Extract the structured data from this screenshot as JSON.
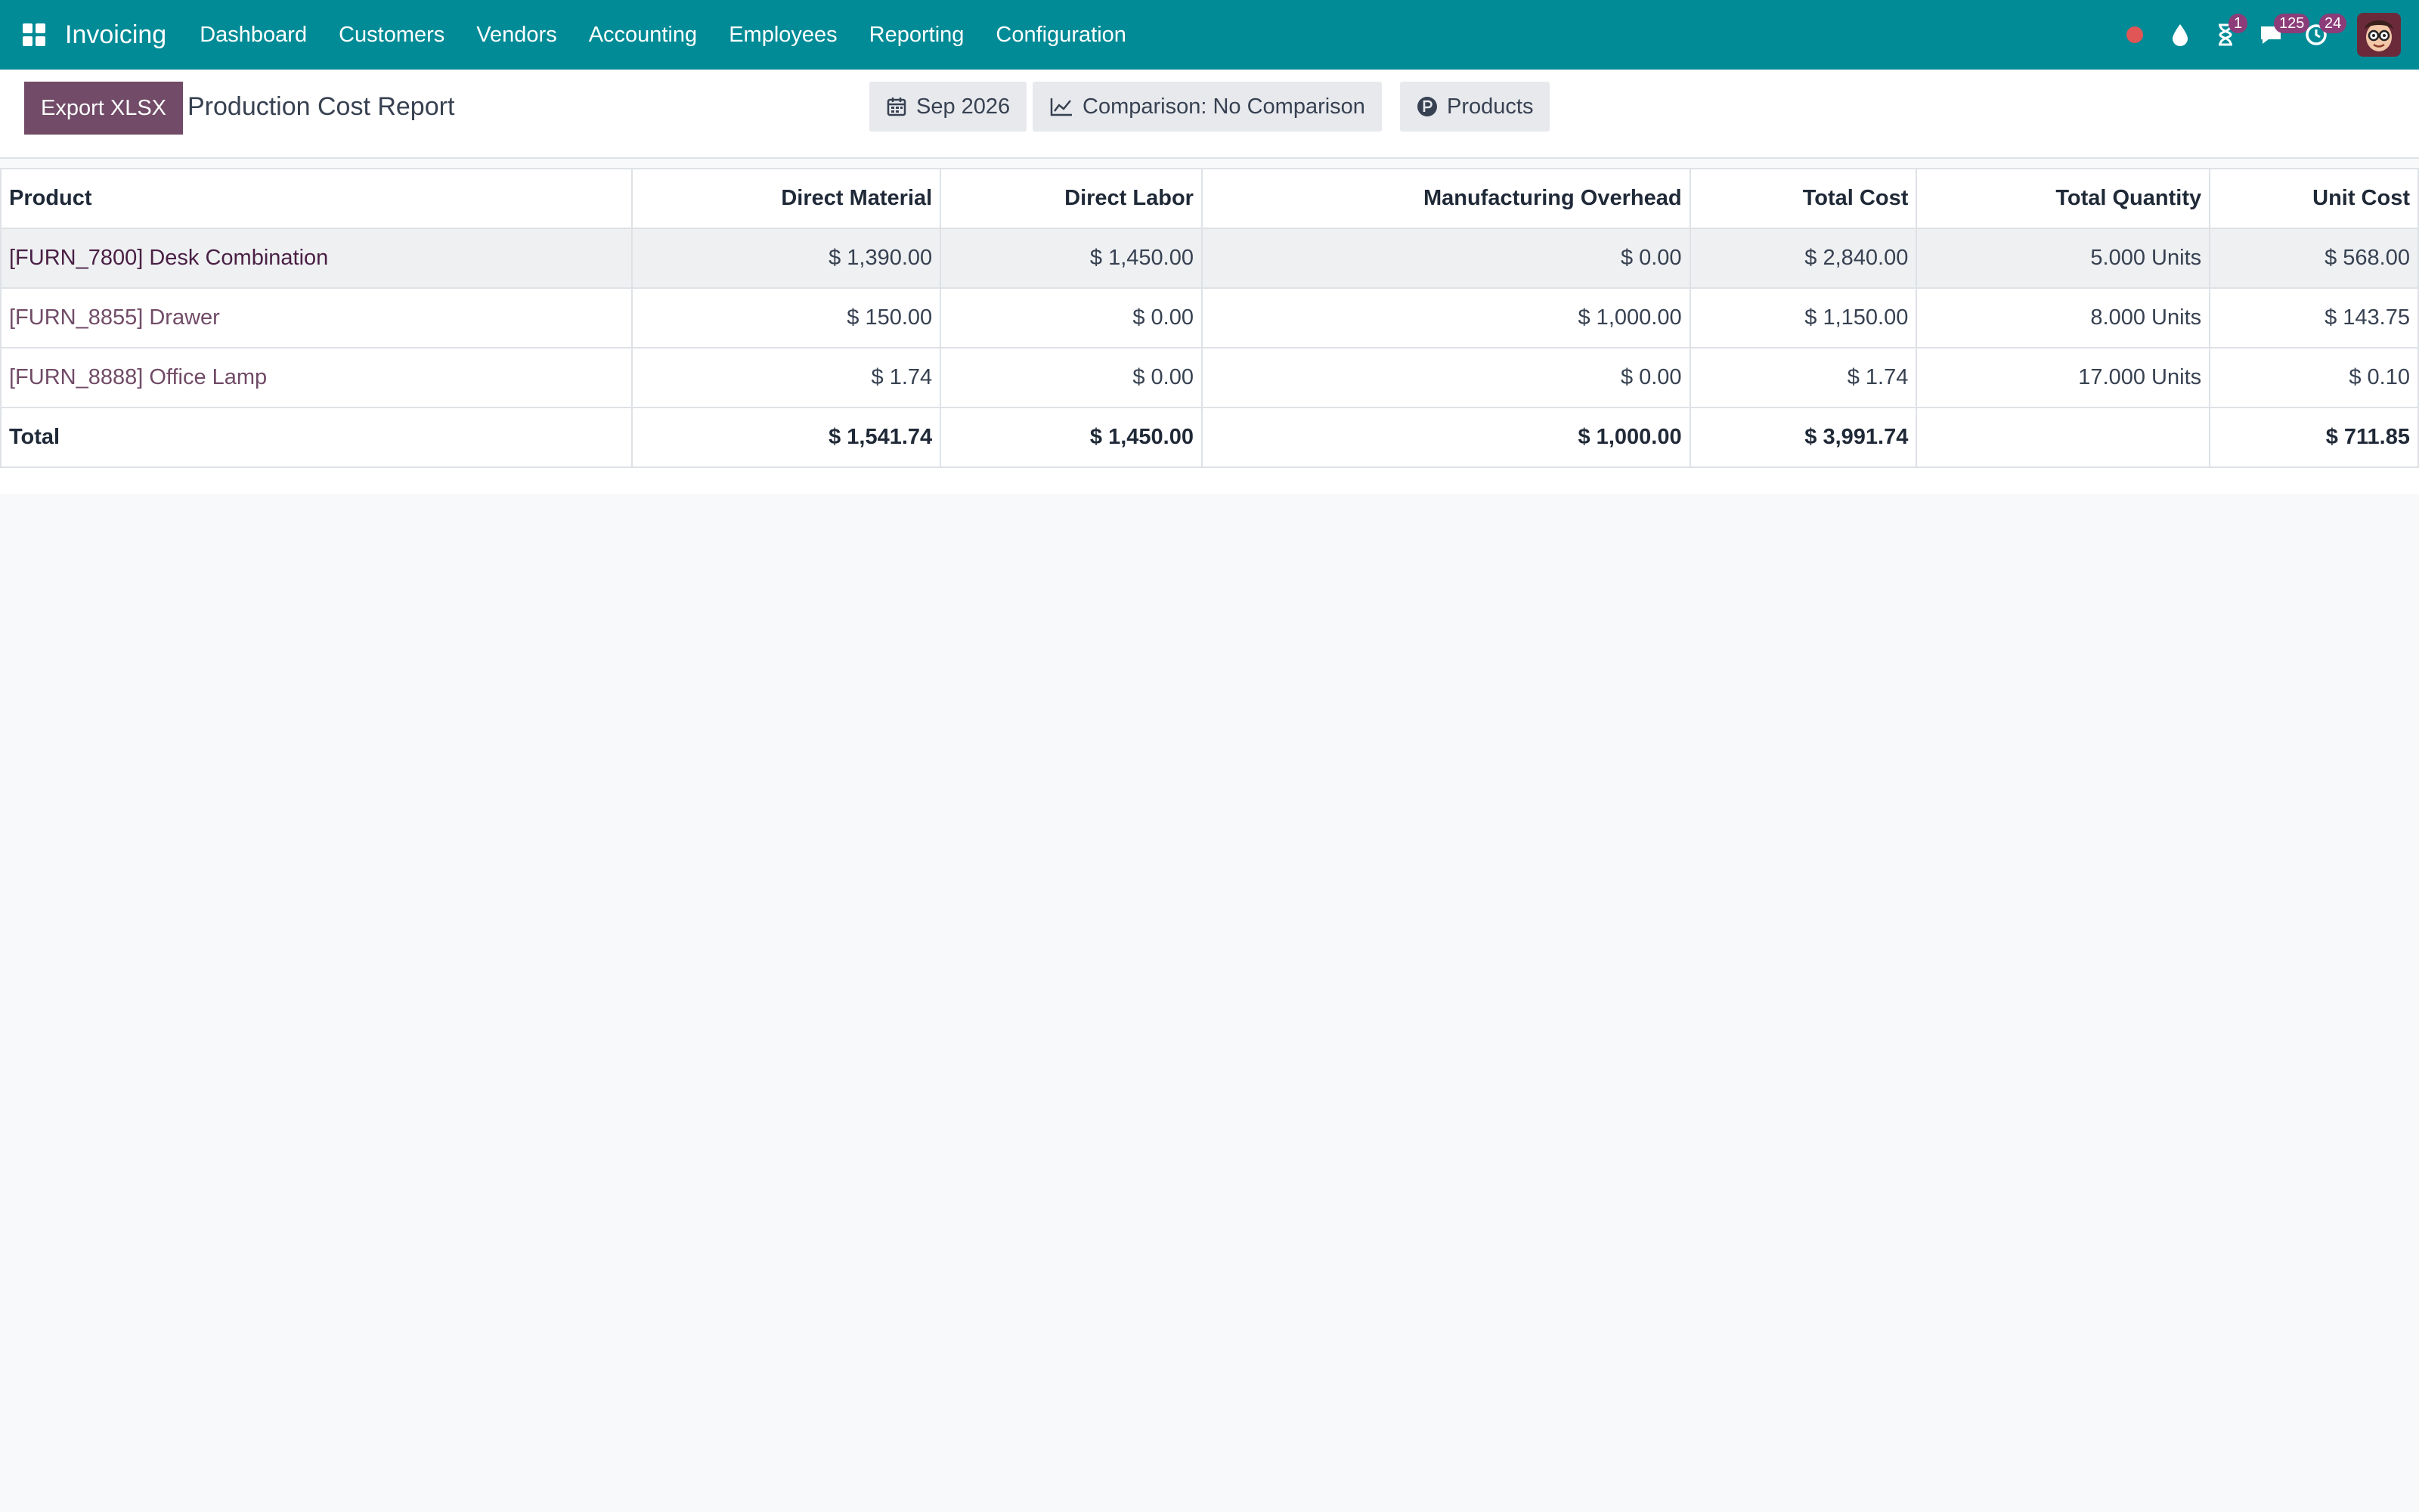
{
  "navbar": {
    "app_name": "Invoicing",
    "menu": [
      "Dashboard",
      "Customers",
      "Vendors",
      "Accounting",
      "Employees",
      "Reporting",
      "Configuration"
    ],
    "activity_badge": "1",
    "messages_badge": "125",
    "updates_badge": "24",
    "icons": [
      "apps-grid-icon",
      "record-dot-icon",
      "droplet-icon",
      "hourglass-icon",
      "chat-icon",
      "clock-icon",
      "avatar"
    ]
  },
  "control_panel": {
    "export_label": "Export XLSX",
    "title": "Production Cost Report",
    "date_filter": "Sep 2026",
    "comparison_filter": "Comparison: No Comparison",
    "products_filter": "Products"
  },
  "report": {
    "columns": [
      "Product",
      "Direct Material",
      "Direct Labor",
      "Manufacturing Overhead",
      "Total Cost",
      "Total Quantity",
      "Unit Cost"
    ],
    "rows": [
      [
        "[FURN_7800] Desk Combination",
        "$ 1,390.00",
        "$ 1,450.00",
        "$ 0.00",
        "$ 2,840.00",
        "5.000 Units",
        "$ 568.00"
      ],
      [
        "[FURN_8855] Drawer",
        "$ 150.00",
        "$ 0.00",
        "$ 1,000.00",
        "$ 1,150.00",
        "8.000 Units",
        "$ 143.75"
      ],
      [
        "[FURN_8888] Office Lamp",
        "$ 1.74",
        "$ 0.00",
        "$ 0.00",
        "$ 1.74",
        "17.000 Units",
        "$ 0.10"
      ]
    ],
    "total": [
      "Total",
      "$ 1,541.74",
      "$ 1,450.00",
      "$ 1,000.00",
      "$ 3,991.74",
      "",
      "$ 711.85"
    ]
  },
  "colors": {
    "navbar": "#008b96",
    "primary": "#714b67",
    "badge": "#8c3c79",
    "record_dot": "#e05555"
  }
}
